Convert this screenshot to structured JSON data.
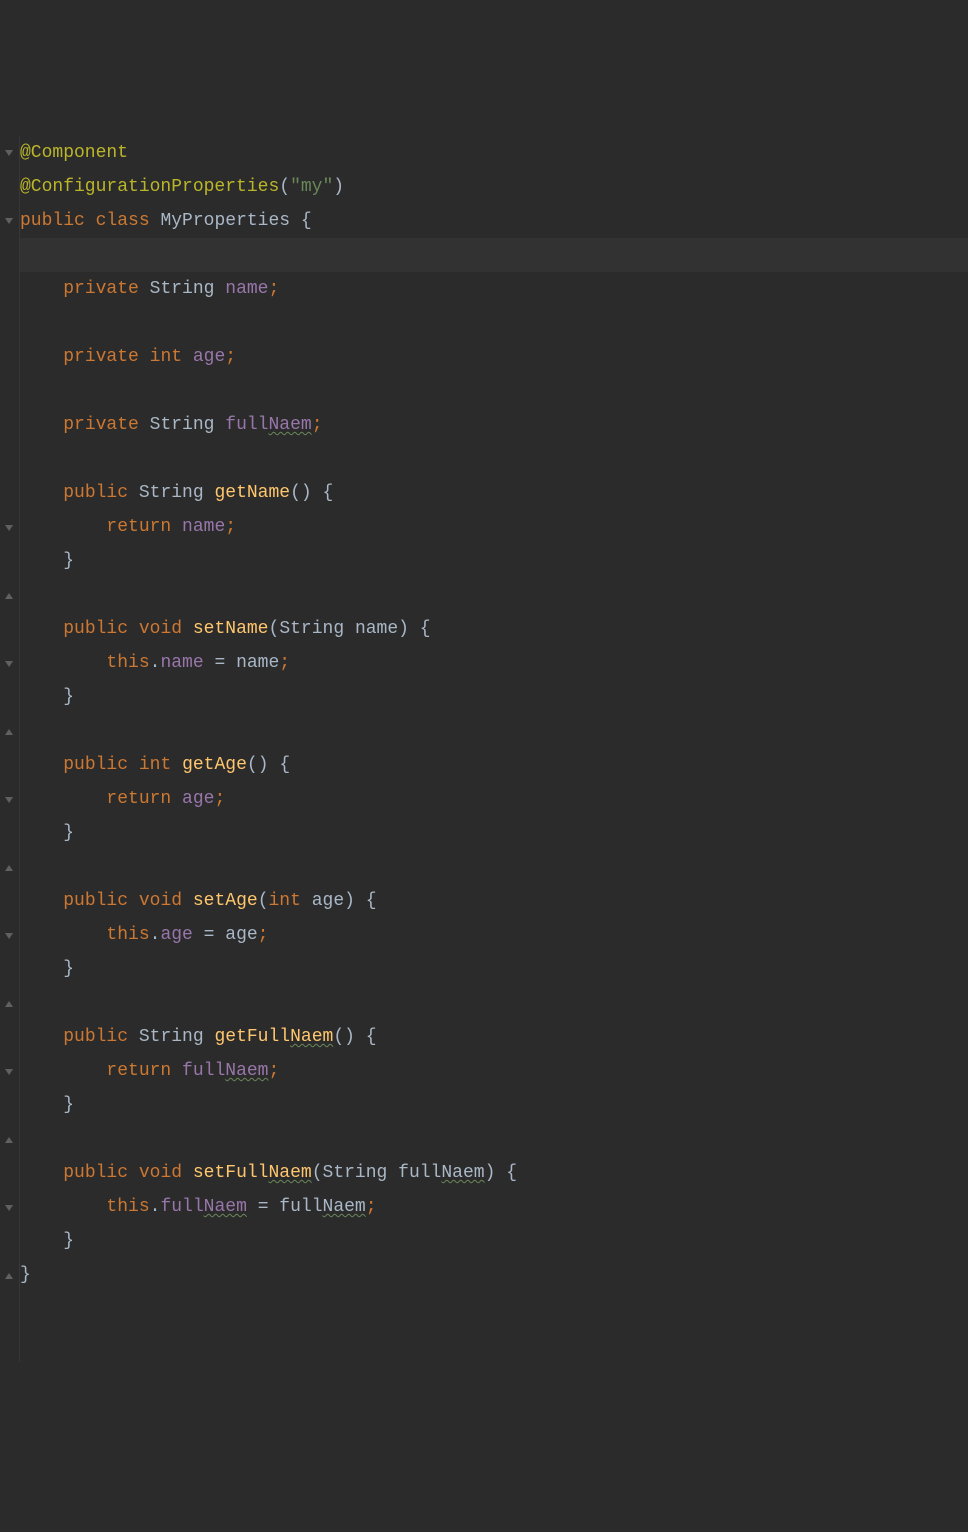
{
  "colors": {
    "background": "#2b2b2b",
    "caret_line": "#323232",
    "annotation": "#bbb529",
    "keyword": "#cc7832",
    "string": "#6a8759",
    "method": "#ffc66d",
    "field": "#9876aa",
    "default": "#a9b7c6"
  },
  "code": {
    "annotation_component": "@Component",
    "annotation_configprops": "@ConfigurationProperties",
    "configprops_arg": "\"my\"",
    "kw_public": "public",
    "kw_class": "class",
    "class_name": "MyProperties",
    "brace_open": "{",
    "brace_close": "}",
    "kw_private": "private",
    "type_string": "String",
    "type_int": "int",
    "kw_void": "void",
    "field_name": "name",
    "field_age": "age",
    "field_fullnaem_prefix": "full",
    "field_fullnaem_typo": "Naem",
    "method_getname": "getName",
    "method_setname": "setName",
    "method_getage": "getAge",
    "method_setage": "setAge",
    "method_getfullnaem_prefix": "getFull",
    "method_getfullnaem_typo": "Naem",
    "method_setfullnaem_prefix": "setFull",
    "method_setfullnaem_typo": "Naem",
    "kw_return": "return",
    "kw_this": "this",
    "param_name": "name",
    "param_age": "age",
    "param_fullnaem_prefix": "full",
    "param_fullnaem_typo": "Naem",
    "semi": ";",
    "paren_open": "(",
    "paren_close": ")",
    "eq": " = ",
    "dot": "."
  }
}
